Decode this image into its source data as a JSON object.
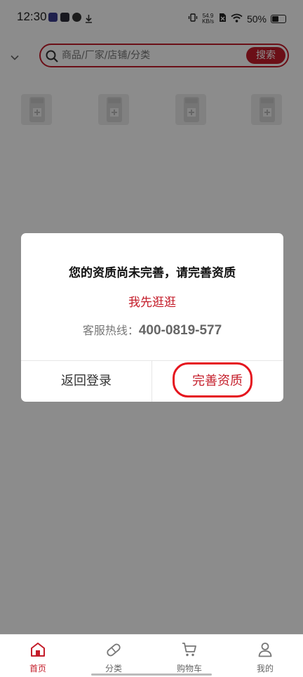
{
  "status_bar": {
    "time": "12:30",
    "net_speed_value": "54.9",
    "net_speed_unit": "KB/s",
    "battery_percent": "50%"
  },
  "header": {
    "search_placeholder": "商品/厂家/店铺/分类",
    "search_button_label": "搜索"
  },
  "products": {
    "items": [
      "product-thumbnail",
      "product-thumbnail",
      "product-thumbnail",
      "product-thumbnail"
    ]
  },
  "dialog": {
    "title": "您的资质尚未完善，请完善资质",
    "browse_link": "我先逛逛",
    "hotline_label": "客服热线：",
    "hotline_number": "400-0819-577",
    "cancel_button": "返回登录",
    "confirm_button": "完善资质"
  },
  "bottom_nav": {
    "tabs": [
      {
        "label": "首页",
        "icon": "home-icon",
        "active": true
      },
      {
        "label": "分类",
        "icon": "pill-icon",
        "active": false
      },
      {
        "label": "购物车",
        "icon": "cart-icon",
        "active": false
      },
      {
        "label": "我的",
        "icon": "user-icon",
        "active": false
      }
    ]
  },
  "colors": {
    "accent": "#c41d2a",
    "overlay": "rgba(0,0,0,0.45)",
    "annotation": "#e5151e"
  },
  "battery_level": 0.5
}
